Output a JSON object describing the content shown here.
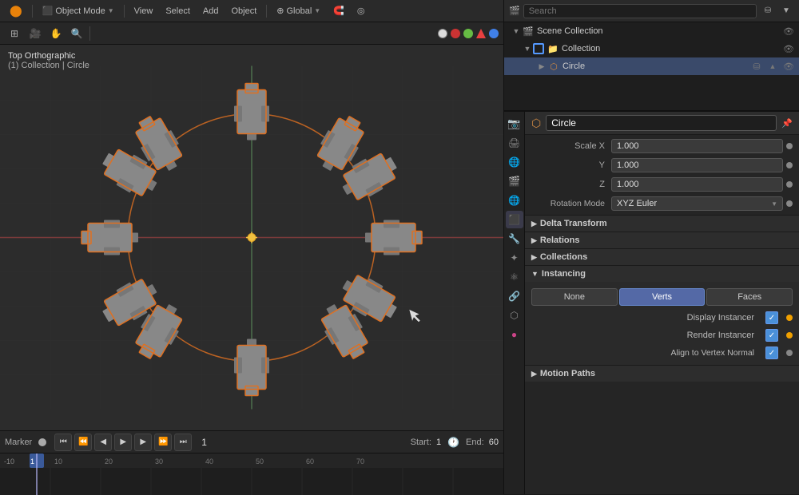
{
  "app": {
    "mode": "Object Mode",
    "view_menu": "View",
    "select_menu": "Select",
    "add_menu": "Add",
    "object_menu": "Object",
    "transform": "Global",
    "title": "Blender"
  },
  "viewport": {
    "view_type": "Top Orthographic",
    "collection_path": "(1) Collection | Circle",
    "tools": [
      "grid",
      "camera",
      "hand",
      "zoom"
    ]
  },
  "outliner": {
    "scene_label": "Scene Collection",
    "collection_label": "Collection",
    "circle_label": "Circle"
  },
  "properties": {
    "object_name": "Circle",
    "scale_label": "Scale X",
    "scale_x": "1.000",
    "scale_y": "1.000",
    "scale_z": "1.000",
    "y_label": "Y",
    "z_label": "Z",
    "rotation_mode_label": "Rotation Mode",
    "rotation_mode_value": "XYZ Euler",
    "delta_transform_label": "Delta Transform",
    "relations_label": "Relations",
    "collections_label": "Collections",
    "instancing_label": "Instancing",
    "none_btn": "None",
    "verts_btn": "Verts",
    "faces_btn": "Faces",
    "display_instancer_label": "Display Instancer",
    "render_instancer_label": "Render Instancer",
    "align_vertex_label": "Align to Vertex Normal",
    "motion_paths_label": "Motion Paths"
  },
  "timeline": {
    "current_frame": "1",
    "start_label": "Start:",
    "start_value": "1",
    "end_label": "End:",
    "end_value": "60",
    "marker_label": "Marker",
    "markers": [
      -10,
      1,
      10,
      20,
      30,
      40,
      50,
      60,
      70
    ]
  },
  "axis_colors": {
    "x": "#e84040",
    "y": "#80cc40",
    "z": "#4080e8"
  },
  "nav_dots": {
    "red": "#cc3333",
    "green": "#66bb44",
    "blue": "#4488cc",
    "white": "#dddddd"
  },
  "icons": {
    "object_mode": "⬛",
    "view": "👁",
    "grid": "⊞",
    "camera": "🎥",
    "hand": "✋",
    "zoom": "🔍",
    "scene": "🎬",
    "collection": "📁",
    "mesh": "⬡",
    "eye": "👁",
    "funnel": "⛁",
    "triangle": "▲",
    "arrow_right": "▶",
    "arrow_down": "▼",
    "settings": "⚙",
    "wrench": "🔧",
    "particles": "✦",
    "physics": "⚛",
    "constraints": "🔗",
    "object_data": "⬡",
    "material": "●",
    "render": "📷",
    "scene_props": "🎬",
    "world": "🌐",
    "output": "🖨"
  }
}
